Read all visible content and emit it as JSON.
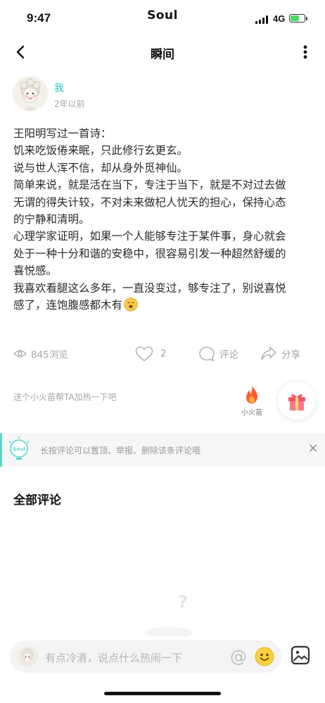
{
  "status_bar": {
    "time": "9:47",
    "app_name": "Soul",
    "network": "4G"
  },
  "nav": {
    "title": "瞬间",
    "back_icon": "chevron-left-icon",
    "more_icon": "more-vertical-icon"
  },
  "post": {
    "author": "我",
    "time": "2年以前",
    "lines": [
      "王阳明写过一首诗：",
      "饥来吃饭倦来眠，只此修行玄更玄。",
      "说与世人浑不信，却从身外觅神仙。",
      "简单来说，就是活在当下，专注于当下，就是不对过去做",
      "无谓的得失计较，不对未来做杞人忧天的担心，保持心态",
      "的宁静和清明。",
      "心理学家证明，如果一个人能够专注于某件事，身心就会",
      "处于一种十分和谐的安稳中，很容易引发一种超然舒缓的",
      "喜悦感。",
      "我喜欢看腿这么多年，一直没变过，够专注了，别说喜悦",
      "感了，连饱腹感都木有"
    ],
    "trailing_emoji": "drooling-face-emoji",
    "views": "845浏览",
    "likes": "2",
    "comment_label": "评论",
    "share_label": "分享"
  },
  "boost": {
    "text": "送个小火苗帮TA加热一下吧",
    "fire_label": "小火苗",
    "gift_icon": "gift-icon"
  },
  "tip": {
    "badge": "Soul",
    "text": "长按评论可以置顶、举报、删除该条评论哦",
    "close": "×"
  },
  "comments": {
    "section_title": "全部评论"
  },
  "composer": {
    "placeholder": "有点冷清，说点什么热闹一下",
    "at_symbol": "@"
  },
  "colors": {
    "accent": "#25c6c0",
    "muted": "#a6a6a6",
    "tip_bg": "#f6f6f6",
    "fire": "#ff5a2c",
    "gift": "#f2546a"
  }
}
